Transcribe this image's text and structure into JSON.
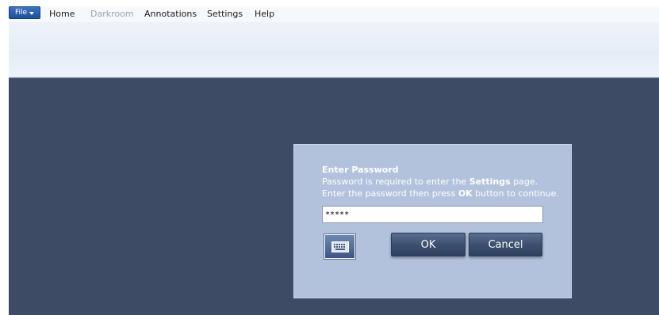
{
  "menubar": {
    "file_label": "File",
    "items": [
      {
        "label": "Home",
        "enabled": true
      },
      {
        "label": "Darkroom",
        "enabled": false
      },
      {
        "label": "Annotations",
        "enabled": true
      },
      {
        "label": "Settings",
        "enabled": true
      },
      {
        "label": "Help",
        "enabled": true
      }
    ]
  },
  "dialog": {
    "title": "Enter Password",
    "line1_prefix": "Password is required to enter the ",
    "line1_bold": "Settings",
    "line1_suffix": " page.",
    "line2_prefix": "Enter the password then press ",
    "line2_bold": "OK",
    "line2_suffix": " button to continue.",
    "password_value": "*****",
    "ok_label": "OK",
    "cancel_label": "Cancel",
    "keyboard_icon": "keyboard-icon"
  },
  "colors": {
    "content_background": "#3d4b65",
    "dialog_background": "#b2c2dc",
    "file_button": "#2a5fb0"
  }
}
